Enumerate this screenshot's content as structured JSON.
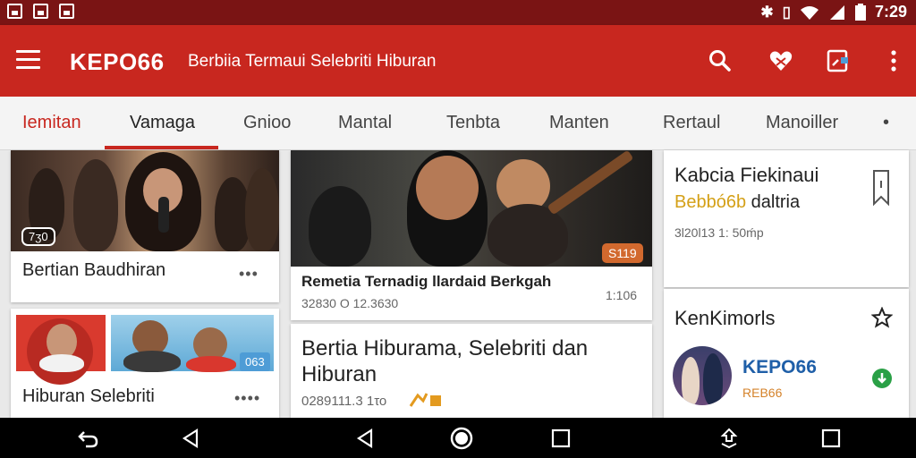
{
  "status_bar": {
    "time": "7:29"
  },
  "app_bar": {
    "title": "KEPO66",
    "subtitle": "Berbiia Termaui Selebriti Hiburan",
    "icons": [
      "menu-icon",
      "search-icon",
      "favorite-icon",
      "cast-icon",
      "more-vert-icon"
    ]
  },
  "tabs": [
    {
      "label": "Iemitan"
    },
    {
      "label": "Vamaga"
    },
    {
      "label": "Gnioo"
    },
    {
      "label": "Mantal"
    },
    {
      "label": "Tenbta"
    },
    {
      "label": "Manten"
    },
    {
      "label": "Rertaul"
    },
    {
      "label": "Manoiller"
    },
    {
      "label": "•"
    }
  ],
  "cards": {
    "left_top": {
      "badge": "7ʒ0",
      "title": "Bertian Baudhiran",
      "more": "•••"
    },
    "left_bottom": {
      "badge": "063",
      "title": "Hiburan Selebriti",
      "more": "••••"
    },
    "middle_top": {
      "badge": "S119",
      "title": "Remetia Ternadig llardaid Berkgah",
      "meta": "32830 O 12.3630",
      "duration": "1:106"
    },
    "middle_bottom": {
      "title_line1": "Bertia Hiburama, Selebriti dan",
      "title_line2": "Hiburan",
      "meta": "0289111.3 1το"
    },
    "right_top": {
      "title": "Kabcia Fiekinaui",
      "highlight": "Bebbó6b",
      "highlight_rest": " daltria",
      "meta": "3l20l13 1: 50ḿp"
    },
    "right_bottom": {
      "title": "KenKimorls",
      "channel_name": "KEPO66",
      "channel_sub": "REB66"
    }
  },
  "colors": {
    "primary": "#c8271f",
    "status_bar": "#7a1414",
    "channel_blue": "#1f5fa8",
    "highlight": "#d4a017",
    "green_badge": "#2aa046"
  }
}
